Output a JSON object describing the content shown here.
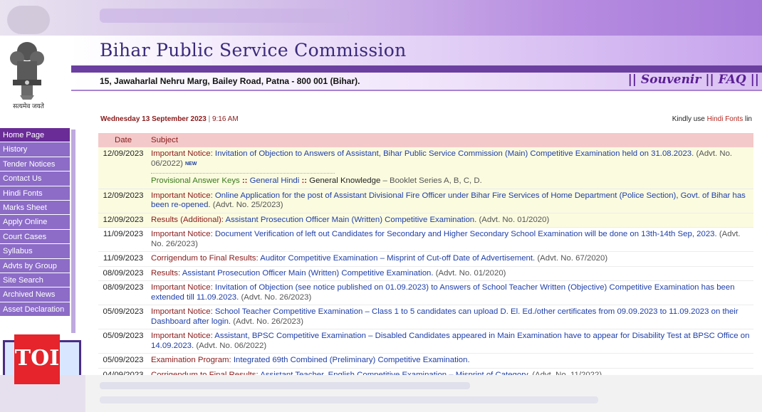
{
  "header": {
    "title": "Bihar Public Service Commission",
    "address": "15, Jawaharlal Nehru Marg, Bailey Road, Patna - 800 001 (Bihar).",
    "emblem_caption": "सत्यमेव जयते",
    "links": [
      "|| Souvenir",
      "|| FAQ ||"
    ]
  },
  "sidebar": {
    "items": [
      {
        "label": "Home Page",
        "active": true
      },
      {
        "label": "History"
      },
      {
        "label": "Tender Notices"
      },
      {
        "label": "Contact Us"
      },
      {
        "label": "Hindi Fonts"
      },
      {
        "label": "Marks Sheet"
      },
      {
        "label": "Apply Online"
      },
      {
        "label": "Court Cases"
      },
      {
        "label": "Syllabus"
      },
      {
        "label": "Advts by Group"
      },
      {
        "label": "Site Search"
      },
      {
        "label": "Archived News"
      },
      {
        "label": "Asset Declaration"
      }
    ]
  },
  "watermark": "TOI",
  "status": {
    "date": "Wednesday 13 September 2023",
    "separator": "|",
    "time": "9:16 AM",
    "hindi_note_prefix": "Kindly use ",
    "hindi_note_link": "Hindi Fonts",
    "hindi_note_suffix": " lin"
  },
  "table": {
    "headers": [
      "Date",
      "Subject"
    ],
    "rows": [
      {
        "date": "12/09/2023",
        "label": "Important Notice:",
        "link": "Invitation of Objection to Answers of Assistant, Bihar Public Service Commission (Main) Competitive Examination held on 31.08.2023.",
        "advt": "(Advt. No. 06/2022)",
        "badge": "NEW",
        "sub": {
          "label": "Provisional Answer Keys",
          "sep1": "::",
          "link1": "General Hindi",
          "sep2": "::",
          "text2": "General Knowledge",
          "dash": "–",
          "booklet": "Booklet Series A, B, C, D."
        }
      },
      {
        "date": "12/09/2023",
        "label": "Important Notice:",
        "link": "Online Application for the post of Assistant Divisional Fire Officer under Bihar Fire Services of Home Department (Police Section), Govt. of Bihar has been re-opened.",
        "advt": "(Advt. No. 25/2023)"
      },
      {
        "date": "12/09/2023",
        "label": "Results (Additional):",
        "link": "Assistant Prosecution Officer Main (Written) Competitive Examination.",
        "advt": "(Advt. No. 01/2020)"
      },
      {
        "date": "11/09/2023",
        "label": "Important Notice:",
        "link": "Document Verification of left out Candidates for Secondary and Higher Secondary School Examination will be done on 13th-14th Sep, 2023.",
        "advt": "(Advt. No. 26/2023)"
      },
      {
        "date": "11/09/2023",
        "label": "Corrigendum to Final Results:",
        "link": "Auditor Competitive Examination – Misprint of Cut-off Date of Advertisement.",
        "advt": "(Advt. No. 67/2020)"
      },
      {
        "date": "08/09/2023",
        "label": "Results:",
        "link": "Assistant Prosecution Officer Main (Written) Competitive Examination.",
        "advt": "(Advt. No. 01/2020)"
      },
      {
        "date": "08/09/2023",
        "label": "Important Notice:",
        "link": "Invitation of Objection (see notice published on 01.09.2023) to Answers of School Teacher Written (Objective) Competitive Examination has been extended till 11.09.2023.",
        "advt": "(Advt. No. 26/2023)"
      },
      {
        "date": "05/09/2023",
        "label": "Important Notice:",
        "link": "School Teacher Competitive Examination – Class 1 to 5 candidates can upload D. El. Ed./other certificates from 09.09.2023 to 11.09.2023 on their Dashboard after login.",
        "advt": "(Advt. No. 26/2023)"
      },
      {
        "date": "05/09/2023",
        "label": "Important Notice:",
        "link": "Assistant, BPSC Competitive Examination – Disabled Candidates appeared in Main Examination have to appear for Disability Test at BPSC Office on 14.09.2023.",
        "advt": "(Advt. No. 06/2022)"
      },
      {
        "date": "05/09/2023",
        "label": "Examination Program:",
        "link": "Integrated 69th Combined (Preliminary) Competitive Examination.",
        "advt": ""
      },
      {
        "date": "04/09/2023",
        "label": "Corrigendum to Final Results:",
        "link": "Assistant Teacher, English Competitive Examination – Misprint of Category.",
        "advt": "(Advt. No. 11/2022)"
      }
    ]
  }
}
